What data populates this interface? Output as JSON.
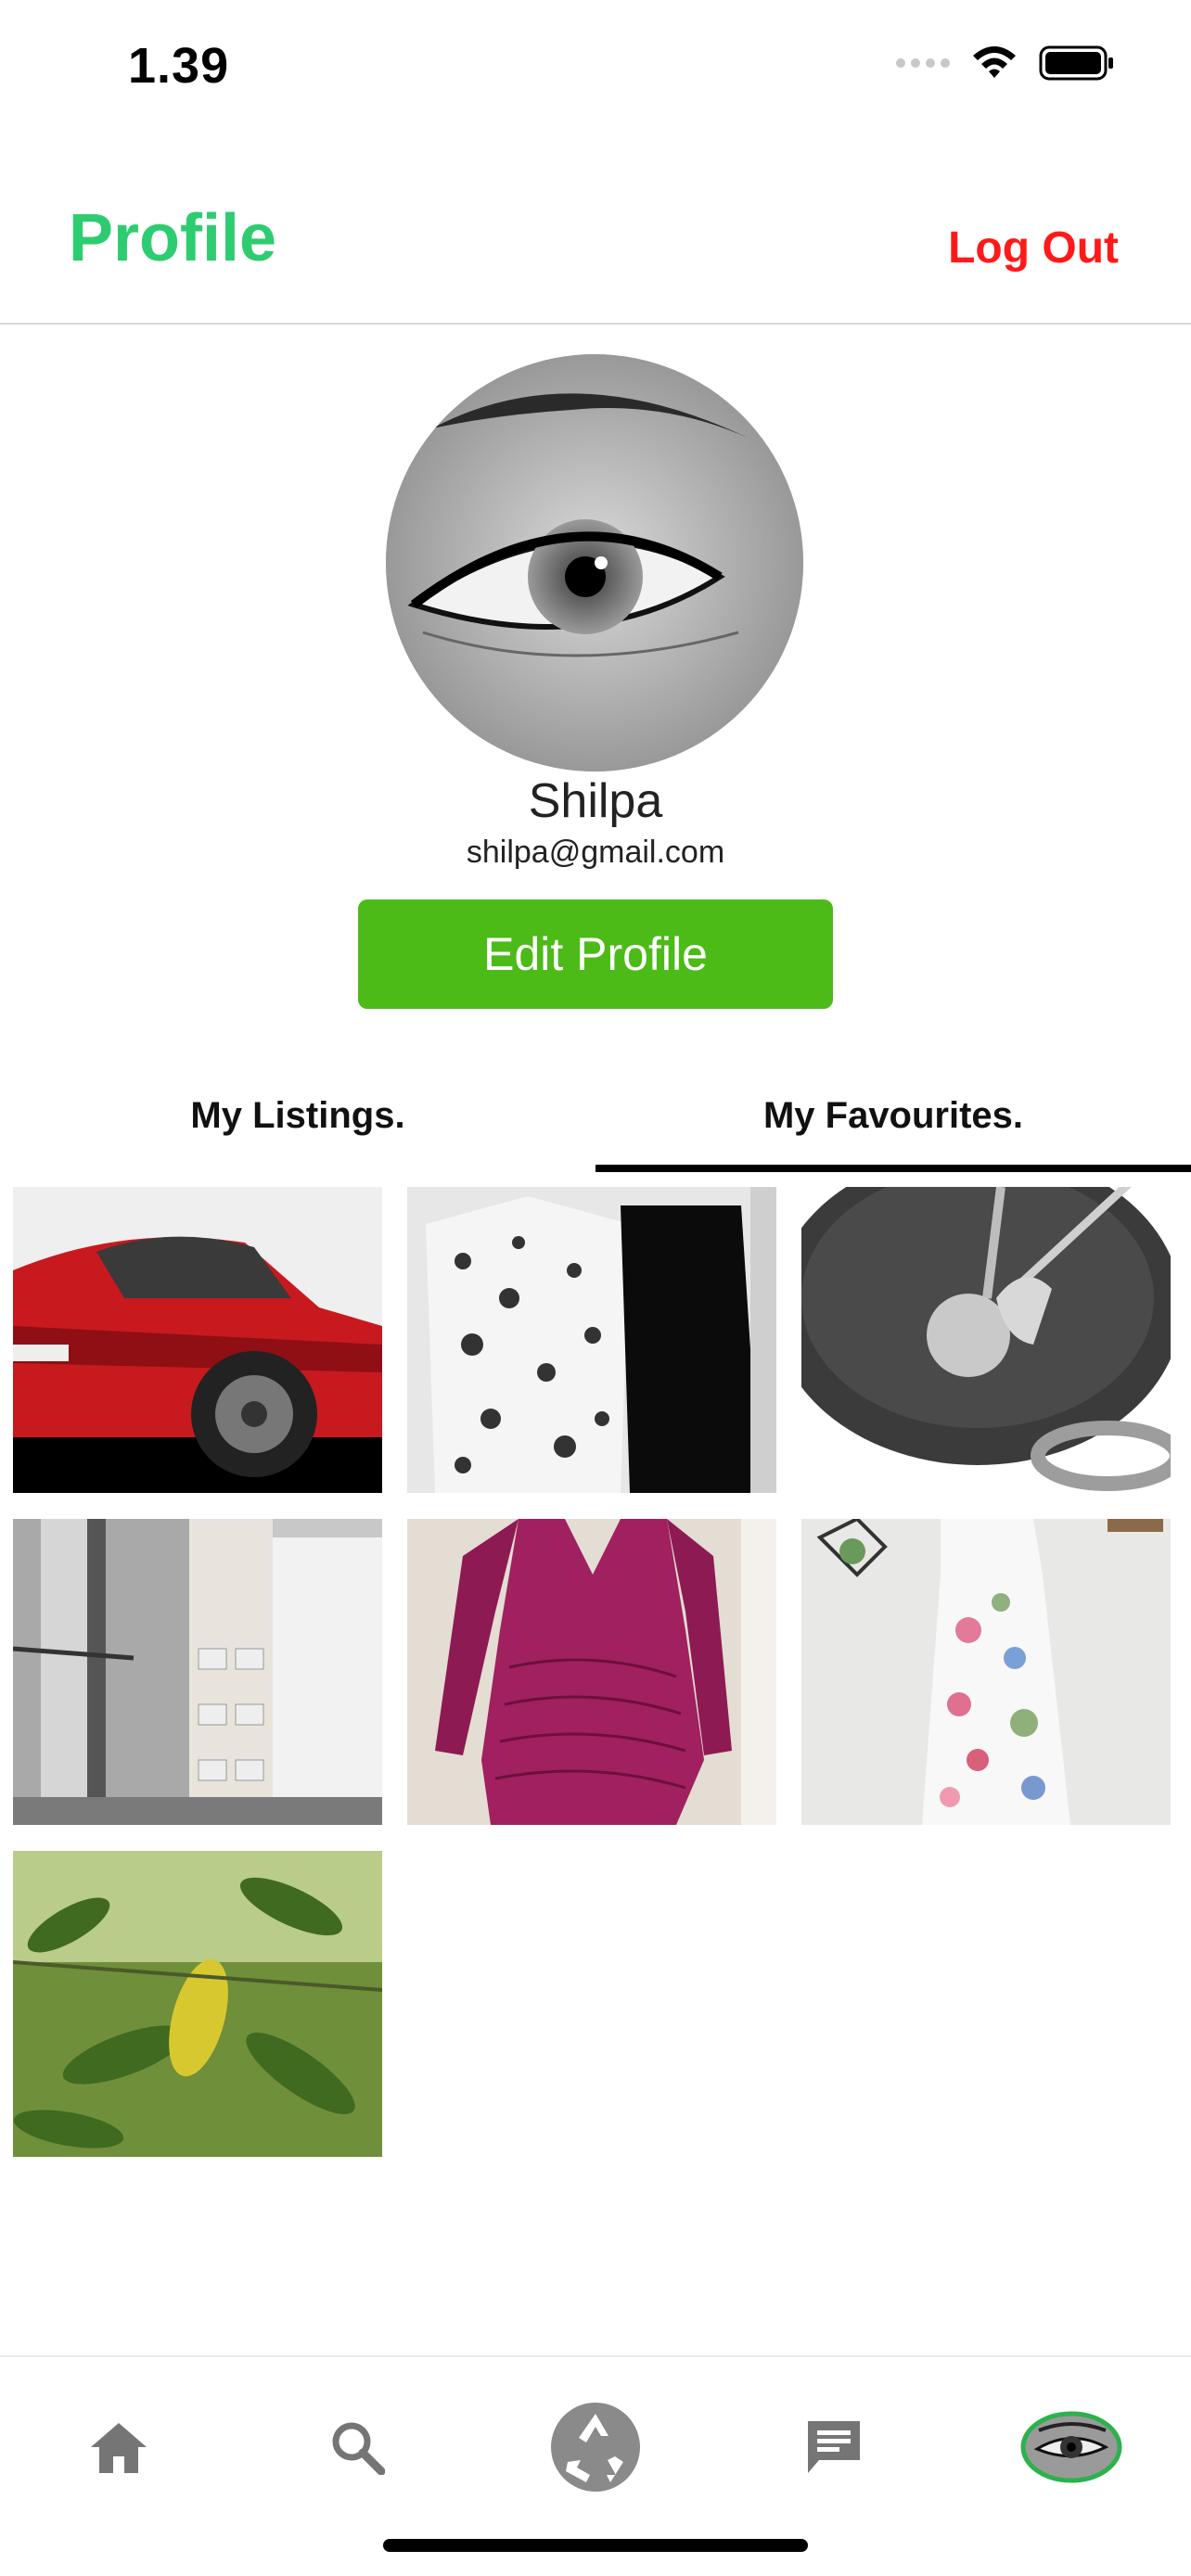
{
  "status_bar": {
    "time": "1.39",
    "wifi_icon": "wifi-icon",
    "battery_icon": "battery-icon",
    "signal_icon": "cellular-signal-icon"
  },
  "header": {
    "title": "Profile",
    "logout_label": "Log Out",
    "title_color": "#2ecc71",
    "logout_color": "#ff1a1a"
  },
  "profile": {
    "name": "Shilpa",
    "email": "shilpa@gmail.com",
    "edit_button_label": "Edit Profile",
    "edit_button_color": "#4cbb17",
    "avatar_icon": "eye-sketch-avatar"
  },
  "tabs": [
    {
      "label": "My Listings.",
      "selected": false
    },
    {
      "label": "My Favourites.",
      "selected": true
    }
  ],
  "favourites": [
    {
      "item": "red-car-photo"
    },
    {
      "item": "floral-dress-and-black-dress-photo"
    },
    {
      "item": "wok-with-ladle-and-spatula-photo"
    },
    {
      "item": "shop-interior-photo"
    },
    {
      "item": "magenta-dress-photo"
    },
    {
      "item": "floral-white-dress-photo"
    },
    {
      "item": "leafy-plant-photo"
    }
  ],
  "bottom_nav": [
    {
      "icon": "home-icon"
    },
    {
      "icon": "search-icon"
    },
    {
      "icon": "recycle-icon"
    },
    {
      "icon": "chat-icon"
    },
    {
      "icon": "profile-avatar-icon",
      "selected": true
    }
  ]
}
